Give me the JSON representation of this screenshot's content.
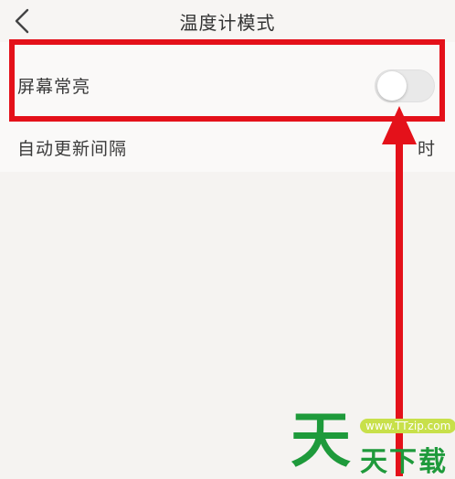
{
  "header": {
    "title": "温度计模式",
    "back_icon": "chevron-left-icon"
  },
  "settings": {
    "screen_on": {
      "label": "屏幕常亮",
      "toggle_on": false
    },
    "auto_update": {
      "label": "自动更新间隔",
      "value": "时"
    }
  },
  "annotation": {
    "highlight_color": "#e4111a"
  },
  "watermark": {
    "big_char": "天",
    "badge": "www.TTzip.com",
    "small_text": "天下载"
  }
}
